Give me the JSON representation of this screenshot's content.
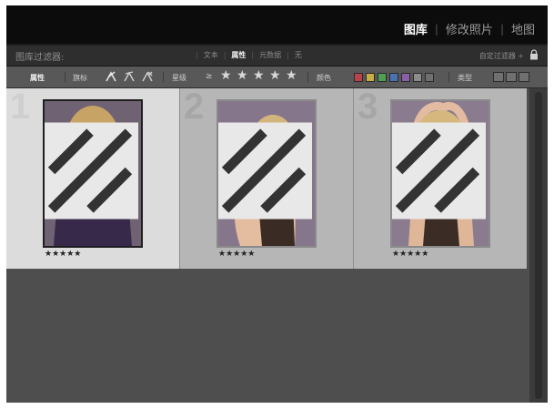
{
  "modules": [
    "图库",
    "修改照片",
    "地图"
  ],
  "active_module": "图库",
  "filter_bar": {
    "title": "图库过滤器:",
    "tabs": [
      "文本",
      "属性",
      "元数据",
      "无"
    ],
    "active_tab": "属性",
    "custom_filter": "自定过滤器 ÷"
  },
  "attribute_bar": {
    "attribute_label": "属性",
    "flag_label": "旗标",
    "rating_label": "星级",
    "rating_operator": "≥",
    "rating_stars": 5,
    "color_label": "颜色",
    "kind_label": "类型",
    "color_chips": [
      "#b8434a",
      "#c6b046",
      "#4f9e55",
      "#4a72b3",
      "#8a5fa6",
      "#8c8c8c",
      "#6f6f6f"
    ]
  },
  "thumbnails": [
    {
      "number": "1",
      "rating": "★★★★★",
      "selected": true
    },
    {
      "number": "2",
      "rating": "★★★★★",
      "selected": false
    },
    {
      "number": "3",
      "rating": "★★★★★",
      "selected": false
    }
  ]
}
